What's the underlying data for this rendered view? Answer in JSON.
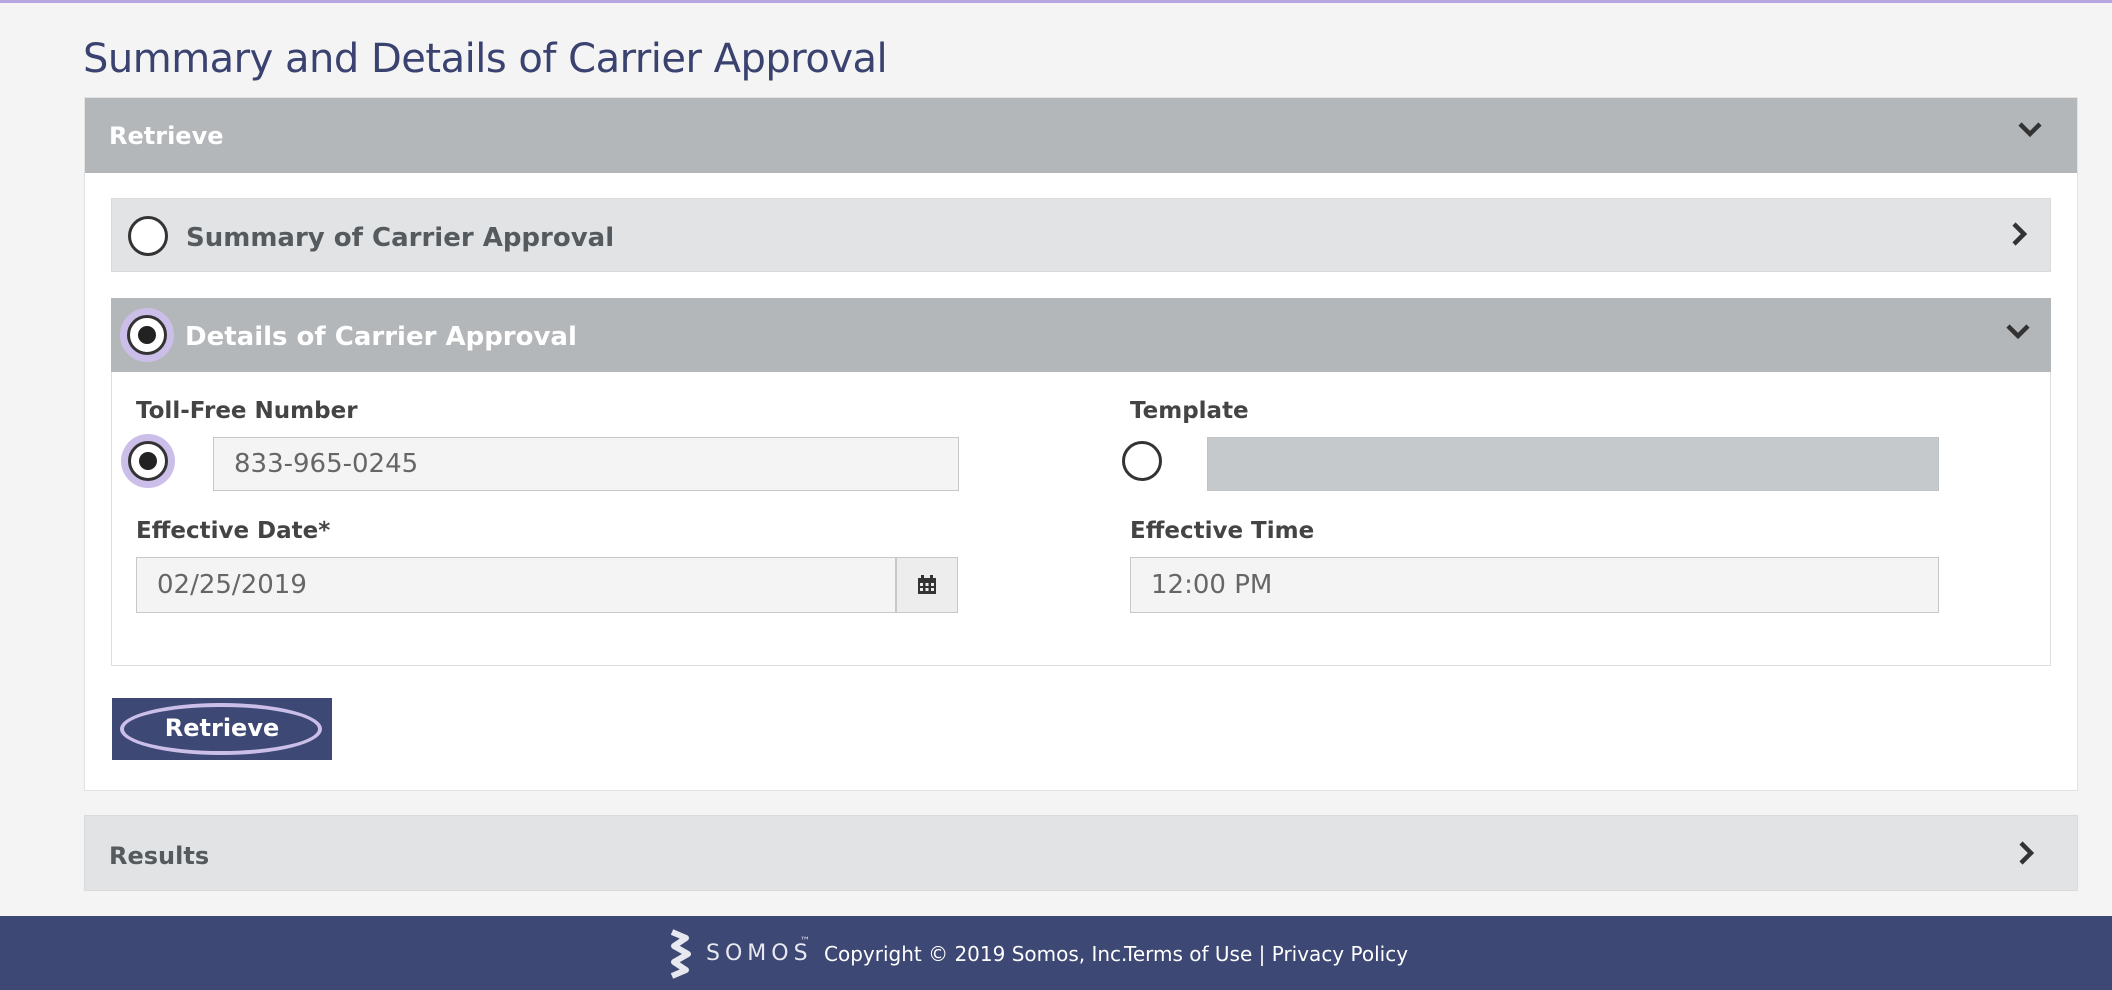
{
  "page": {
    "title": "Summary and Details of Carrier Approval"
  },
  "retrieve_panel": {
    "header_label": "Retrieve",
    "summary_option": {
      "label": "Summary of Carrier Approval",
      "selected": false
    },
    "details_option": {
      "label": "Details of Carrier Approval",
      "selected": true,
      "toll_free_number": {
        "label": "Toll-Free Number",
        "value": "833-965-0245",
        "selected": true
      },
      "template": {
        "label": "Template",
        "value": "",
        "selected": false
      },
      "effective_date": {
        "label": "Effective Date*",
        "value": "02/25/2019"
      },
      "effective_time": {
        "label": "Effective Time",
        "value": "12:00 PM"
      }
    },
    "retrieve_button_label": "Retrieve"
  },
  "results_panel": {
    "header_label": "Results"
  },
  "footer": {
    "logo_text": "SOMOS",
    "logo_tm": "™",
    "copyright": "Copyright © 2019 Somos, Inc.",
    "terms_label": "Terms of Use",
    "separator": "|",
    "privacy_label": "Privacy Policy"
  },
  "colors": {
    "brand_navy": "#3d4874",
    "focus_ring": "#cbbfea",
    "panel_header_gray": "#b3b7b9",
    "panel_light_gray": "#e1e3e4"
  }
}
